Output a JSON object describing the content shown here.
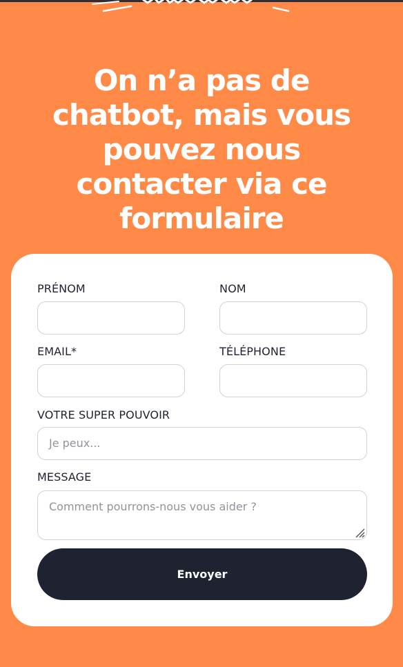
{
  "hero": {
    "title": "On n’a pas de chatbot, mais vous pouvez nous contacter via ce formulaire"
  },
  "form": {
    "first_name": {
      "label": "PRÉNOM",
      "value": ""
    },
    "last_name": {
      "label": "NOM",
      "value": ""
    },
    "email": {
      "label": "EMAIL*",
      "value": ""
    },
    "phone": {
      "label": "TÉLÉPHONE",
      "value": ""
    },
    "superpower": {
      "label": "VOTRE SUPER POUVOIR",
      "placeholder": "Je peux..."
    },
    "message": {
      "label": "MESSAGE",
      "placeholder": "Comment pourrons-nous vous aider ?"
    },
    "submit_label": "Envoyer"
  },
  "colors": {
    "background": "#ff8a48",
    "card": "#ffffff",
    "button": "#1e2231",
    "text_dark": "#1e2231",
    "placeholder": "#8f959c",
    "border": "#cfd2d6"
  }
}
